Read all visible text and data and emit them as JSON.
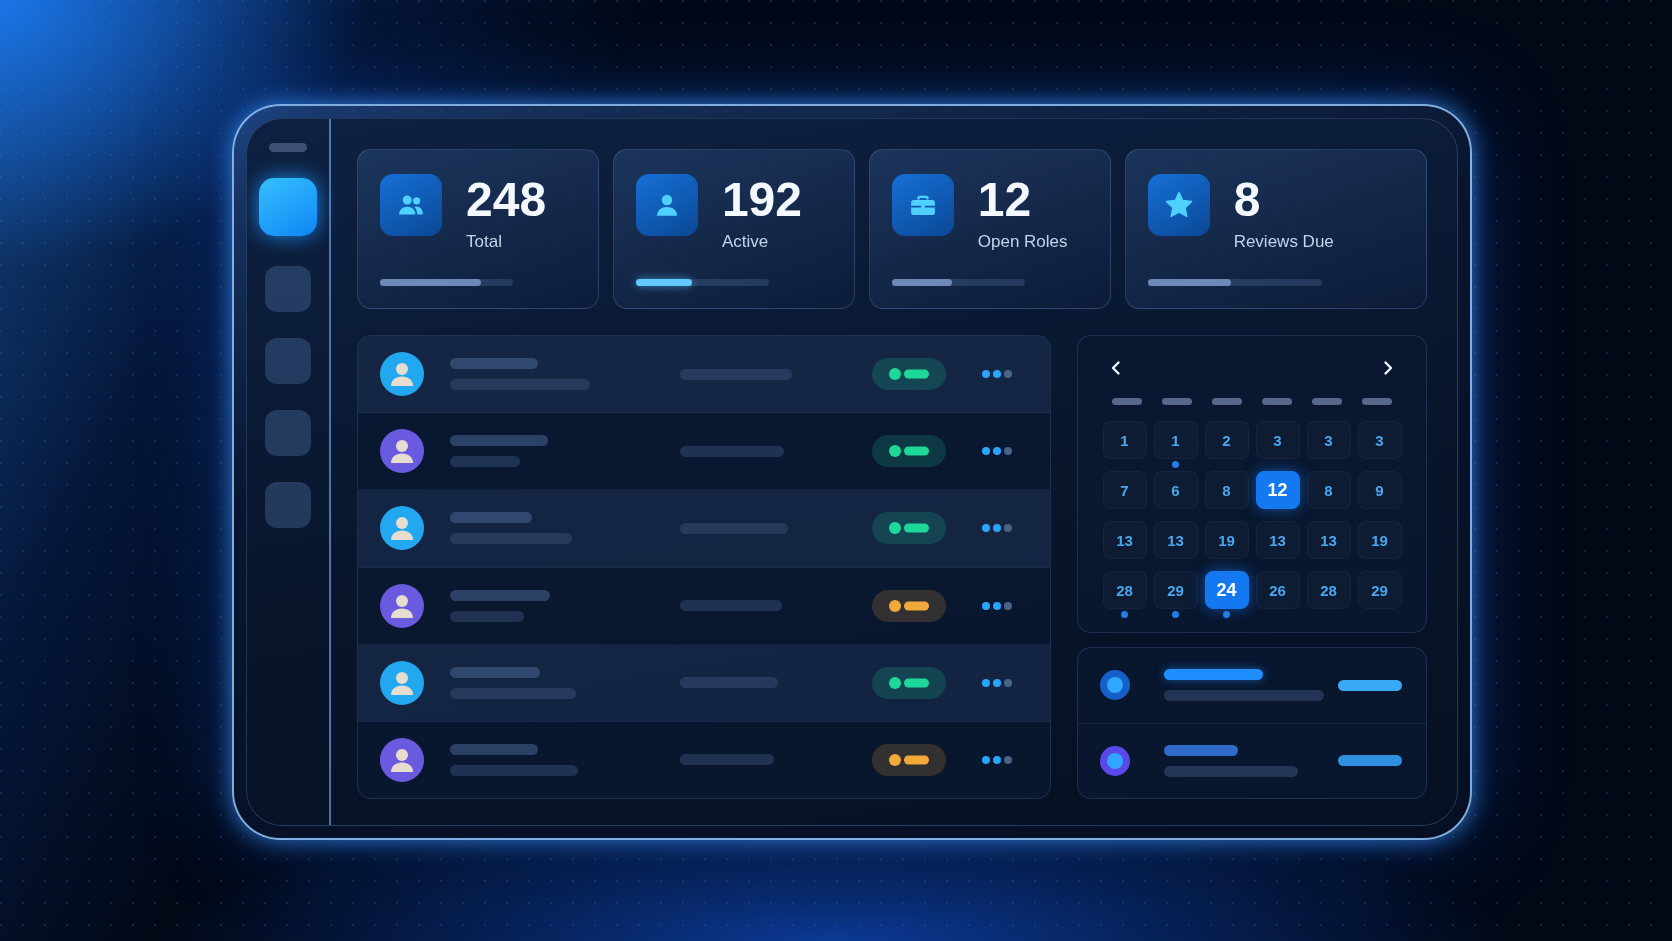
{
  "sidebar": {
    "items": [
      {
        "selected": true
      },
      {
        "selected": false
      },
      {
        "selected": false
      },
      {
        "selected": false
      },
      {
        "selected": false
      }
    ]
  },
  "stats": [
    {
      "value": "248",
      "label": "Total",
      "level": 0.76,
      "highlighted": false
    },
    {
      "value": "192",
      "label": "Active",
      "level": 0.42,
      "highlighted": true
    },
    {
      "value": "12",
      "label": "Open Roles",
      "level": 0.45,
      "highlighted": false
    },
    {
      "value": "8",
      "label": "Reviews Due",
      "level": 0.48,
      "highlighted": false
    }
  ],
  "table": {
    "rows": [
      {
        "avatar": {
          "color": "#22a8f0"
        },
        "status": {
          "color": "#1ed89a"
        }
      },
      {
        "avatar": {
          "color": "#6a5ae0"
        },
        "status": {
          "color": "#1ed89a"
        }
      },
      {
        "avatar": {
          "color": "#22a8f0"
        },
        "status": {
          "color": "#1ed89a"
        }
      },
      {
        "avatar": {
          "color": "#6a5ae0"
        },
        "status": {
          "color": "#f2a93b"
        }
      },
      {
        "avatar": {
          "color": "#22a8f0"
        },
        "status": {
          "color": "#1ed89a"
        }
      },
      {
        "avatar": {
          "color": "#6a5ae0"
        },
        "status": {
          "color": "#f2a93b"
        }
      }
    ]
  },
  "calendar": {
    "days": [
      {
        "label": "1",
        "selected": false,
        "event": false
      },
      {
        "label": "1",
        "selected": false,
        "event": true
      },
      {
        "label": "2",
        "selected": false,
        "event": false
      },
      {
        "label": "3",
        "selected": false,
        "event": false
      },
      {
        "label": "3",
        "selected": false,
        "event": false
      },
      {
        "label": "3",
        "selected": false,
        "event": false
      },
      {
        "label": "7",
        "selected": false,
        "event": false
      },
      {
        "label": "6",
        "selected": false,
        "event": false
      },
      {
        "label": "8",
        "selected": false,
        "event": false
      },
      {
        "label": "12",
        "selected": true,
        "event": false
      },
      {
        "label": "8",
        "selected": false,
        "event": false
      },
      {
        "label": "9",
        "selected": false,
        "event": false
      },
      {
        "label": "13",
        "selected": false,
        "event": false
      },
      {
        "label": "13",
        "selected": false,
        "event": false
      },
      {
        "label": "19",
        "selected": false,
        "event": false
      },
      {
        "label": "13",
        "selected": false,
        "event": false
      },
      {
        "label": "13",
        "selected": false,
        "event": false
      },
      {
        "label": "19",
        "selected": false,
        "event": false
      },
      {
        "label": "28",
        "selected": false,
        "event": true
      },
      {
        "label": "29",
        "selected": false,
        "event": true
      },
      {
        "label": "24",
        "selected": true,
        "event": true
      },
      {
        "label": "26",
        "selected": false,
        "event": false
      },
      {
        "label": "28",
        "selected": false,
        "event": false
      },
      {
        "label": "29",
        "selected": false,
        "event": false
      }
    ]
  },
  "activity": {
    "items": [
      {
        "color": "#1560c8",
        "highlighted": true
      },
      {
        "color": "#5b48e8",
        "highlighted": false
      }
    ]
  }
}
